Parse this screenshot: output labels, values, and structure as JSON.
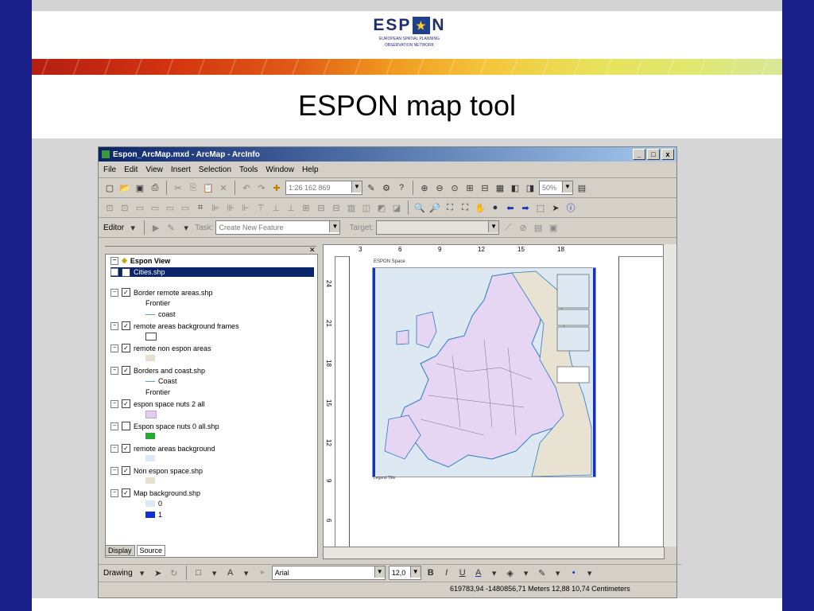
{
  "slide": {
    "logo_word_left": "ESP",
    "logo_word_right": "N",
    "logo_sub1": "EUROPEAN SPATIAL PLANNING",
    "logo_sub2": "OBSERVATION NETWORK",
    "title": "ESPON map tool"
  },
  "window": {
    "title": "Espon_ArcMap.mxd - ArcMap - ArcInfo",
    "controls": [
      "_",
      "□",
      "x"
    ]
  },
  "menu": [
    "File",
    "Edit",
    "View",
    "Insert",
    "Selection",
    "Tools",
    "Window",
    "Help"
  ],
  "standard_toolbar": {
    "scale": "1:26 162 869",
    "zoom": "50%"
  },
  "editor_toolbar": {
    "editor_label": "Editor",
    "task_label": "Task:",
    "task_value": "Create New Feature",
    "target_label": "Target:"
  },
  "toc": {
    "root": "Espon View",
    "layers": [
      {
        "name": "Cities.shp",
        "checked": true,
        "selected": true
      },
      {
        "name": "Border remote areas.shp",
        "checked": true,
        "legend": [
          {
            "label": "Frontier",
            "color": "#ffffff"
          },
          {
            "label": "coast",
            "color": "#5aa0d0"
          }
        ]
      },
      {
        "name": "remote areas background frames",
        "checked": true,
        "legend": [
          {
            "label": "",
            "color": "#ffffff"
          }
        ]
      },
      {
        "name": "remote non espon areas",
        "checked": true,
        "legend": [
          {
            "label": "",
            "color": "#e6e0cf"
          }
        ]
      },
      {
        "name": "Borders and coast.shp",
        "checked": true,
        "legend": [
          {
            "label": "Coast",
            "color": "#5aa0d0"
          },
          {
            "label": "Frontier",
            "color": "#ffffff"
          }
        ]
      },
      {
        "name": "espon space nuts 2 all",
        "checked": true,
        "legend": [
          {
            "label": "",
            "color": "#e0cff0"
          }
        ]
      },
      {
        "name": "Espon space nuts 0 all.shp",
        "checked": false,
        "legend": [
          {
            "label": "",
            "color": "#22aa33"
          }
        ]
      },
      {
        "name": "remote areas background",
        "checked": true,
        "legend": [
          {
            "label": "",
            "color": "#dde8f5"
          }
        ]
      },
      {
        "name": "Non espon space.shp",
        "checked": true,
        "legend": [
          {
            "label": "",
            "color": "#e6e0cf"
          }
        ]
      },
      {
        "name": "Map background.shp",
        "checked": true,
        "legend": [
          {
            "label": "0",
            "color": "#dde8f5"
          },
          {
            "label": "1",
            "color": "#1030d0"
          }
        ]
      }
    ],
    "tabs": [
      "Display",
      "Source"
    ]
  },
  "layout": {
    "page_title": "ESPON Space",
    "legend_title": "Legend Title",
    "h_ruler": [
      "3",
      "6",
      "9",
      "12",
      "15",
      "18"
    ],
    "v_ruler": [
      "24",
      "21",
      "18",
      "15",
      "12",
      "9",
      "6"
    ]
  },
  "drawing_toolbar": {
    "drawing_label": "Drawing",
    "font": "Arial",
    "size": "12,0",
    "buttons": [
      "B",
      "I",
      "U",
      "A"
    ]
  },
  "status": {
    "text": "619783,94  -1480856,71 Meters  12,88  10,74 Centimeters"
  }
}
